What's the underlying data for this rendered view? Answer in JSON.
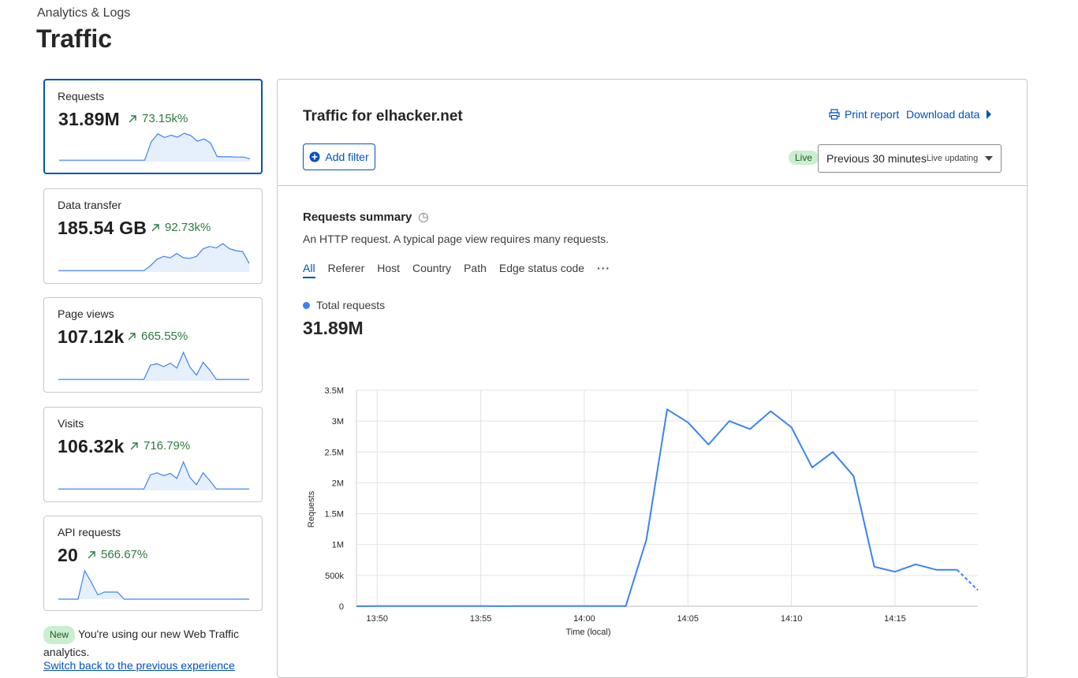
{
  "header": {
    "breadcrumb": "Analytics & Logs",
    "title": "Traffic"
  },
  "cards": [
    {
      "label": "Requests",
      "value": "31.89M",
      "change": "73.15k%",
      "spark": [
        0.05,
        0.05,
        0.05,
        0.05,
        0.05,
        0.05,
        0.05,
        0.05,
        0.05,
        0.05,
        0.05,
        0.05,
        0.05,
        0.05,
        0.7,
        0.98,
        0.85,
        0.93,
        0.86,
        1.0,
        0.92,
        0.72,
        0.8,
        0.66,
        0.18,
        0.17,
        0.17,
        0.16,
        0.16,
        0.1
      ]
    },
    {
      "label": "Data transfer",
      "value": "185.54 GB",
      "change": "92.73k%",
      "spark": [
        0.05,
        0.05,
        0.05,
        0.05,
        0.05,
        0.05,
        0.05,
        0.05,
        0.05,
        0.05,
        0.05,
        0.05,
        0.05,
        0.05,
        0.22,
        0.45,
        0.55,
        0.5,
        0.65,
        0.5,
        0.48,
        0.55,
        0.82,
        0.9,
        0.85,
        1.0,
        0.82,
        0.75,
        0.72,
        0.3
      ]
    },
    {
      "label": "Page views",
      "value": "107.12k",
      "change": "665.55%",
      "spark": [
        0.05,
        0.05,
        0.05,
        0.05,
        0.05,
        0.05,
        0.05,
        0.05,
        0.05,
        0.05,
        0.05,
        0.05,
        0.05,
        0.05,
        0.55,
        0.6,
        0.5,
        0.62,
        0.45,
        1.0,
        0.48,
        0.2,
        0.65,
        0.38,
        0.05,
        0.05,
        0.05,
        0.05,
        0.05,
        0.05
      ]
    },
    {
      "label": "Visits",
      "value": "106.32k",
      "change": "716.79%",
      "spark": [
        0.05,
        0.05,
        0.05,
        0.05,
        0.05,
        0.05,
        0.05,
        0.05,
        0.05,
        0.05,
        0.05,
        0.05,
        0.05,
        0.05,
        0.55,
        0.62,
        0.52,
        0.6,
        0.42,
        1.0,
        0.45,
        0.2,
        0.62,
        0.35,
        0.05,
        0.05,
        0.05,
        0.05,
        0.05,
        0.05
      ]
    },
    {
      "label": "API requests",
      "value": "20",
      "change": "566.67%",
      "spark": [
        0.0,
        0.0,
        0.0,
        0.0,
        1.0,
        0.6,
        0.15,
        0.25,
        0.25,
        0.25,
        0.0,
        0.0,
        0.0,
        0.0,
        0.0,
        0.0,
        0.0,
        0.0,
        0.0,
        0.0,
        0.0,
        0.0,
        0.0,
        0.0,
        0.0,
        0.0,
        0.0,
        0.0,
        0.0,
        0.0
      ]
    }
  ],
  "notice": {
    "badge": "New",
    "text": "You're using our new Web Traffic analytics.",
    "link": "Switch back to the previous experience"
  },
  "panel": {
    "title": "Traffic for elhacker.net",
    "print_report": "Print report",
    "download_data": "Download data",
    "add_filter": "Add filter",
    "live_badge": "Live",
    "time_range": "Previous 30 minutes",
    "time_range_sub": "Live updating"
  },
  "summary": {
    "title": "Requests summary",
    "description": "An HTTP request. A typical page view requires many requests.",
    "tabs": [
      "All",
      "Referer",
      "Host",
      "Country",
      "Path",
      "Edge status code"
    ],
    "legend_label": "Total requests",
    "total": "31.89M"
  },
  "colors": {
    "accent": "#0051c3",
    "series": "#3b82f6",
    "positive": "#2c7a3f",
    "live_bg": "#c9efcf"
  },
  "chart_data": {
    "type": "line",
    "xlabel": "Time (local)",
    "ylabel": "Requests",
    "ylim": [
      0,
      3500000
    ],
    "yticks": [
      "0",
      "500k",
      "1M",
      "1.5M",
      "2M",
      "2.5M",
      "3M",
      "3.5M"
    ],
    "xtick_labels": [
      "13:50",
      "13:55",
      "14:00",
      "14:05",
      "14:10",
      "14:15"
    ],
    "x_minutes_range": [
      "13:49",
      "14:19"
    ],
    "series": [
      {
        "name": "Total requests",
        "x": [
          "13:49",
          "13:50",
          "13:51",
          "13:52",
          "13:53",
          "13:54",
          "13:55",
          "13:56",
          "13:57",
          "13:58",
          "13:59",
          "14:00",
          "14:01",
          "14:02",
          "14:03",
          "14:04",
          "14:05",
          "14:06",
          "14:07",
          "14:08",
          "14:09",
          "14:10",
          "14:11",
          "14:12",
          "14:13",
          "14:14",
          "14:15",
          "14:16",
          "14:17",
          "14:18",
          "14:19"
        ],
        "values": [
          0,
          2000,
          2000,
          2000,
          2000,
          2000,
          2000,
          1000,
          2000,
          2000,
          2000,
          2000,
          2000,
          3000,
          1080000,
          3190000,
          2980000,
          2620000,
          3000000,
          2870000,
          3160000,
          2900000,
          2250000,
          2500000,
          2110000,
          640000,
          560000,
          680000,
          590000,
          590000,
          260000
        ],
        "partial_from_index": 29
      }
    ]
  }
}
